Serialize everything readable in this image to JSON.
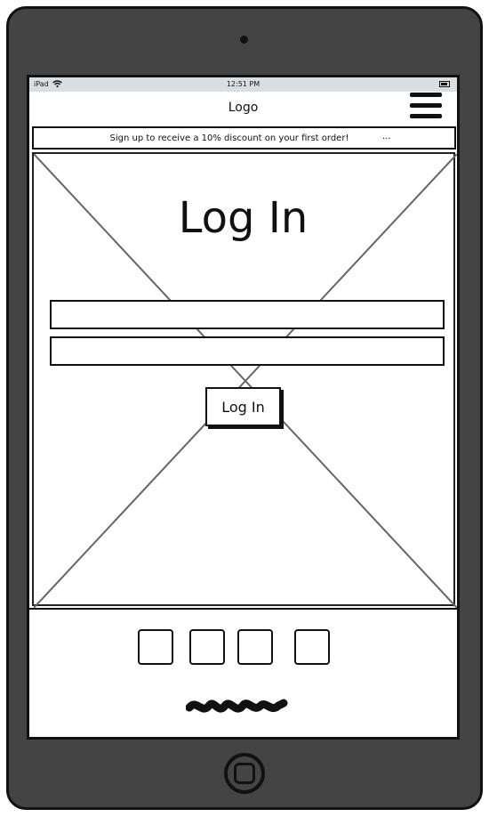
{
  "statusbar": {
    "device": "iPad",
    "time": "12:51 PM",
    "wifi_icon": "wifi-icon",
    "battery_icon": "battery-icon"
  },
  "header": {
    "logo": "Logo",
    "menu_icon": "hamburger-menu-icon"
  },
  "banner": {
    "text": "Sign up to receive a 10% discount on your first order!",
    "more": "..."
  },
  "main": {
    "title": "Log In",
    "username_value": "",
    "password_value": "",
    "login_button": "Log In",
    "background": "image-placeholder"
  },
  "footer": {
    "social_icons": [
      "social-icon-1",
      "social-icon-2",
      "social-icon-3",
      "social-icon-4"
    ],
    "copyright": "scribble-text-placeholder"
  },
  "colors": {
    "device_frame": "#444444",
    "statusbar": "#d9dee3",
    "ink": "#111111",
    "background": "#ffffff"
  }
}
